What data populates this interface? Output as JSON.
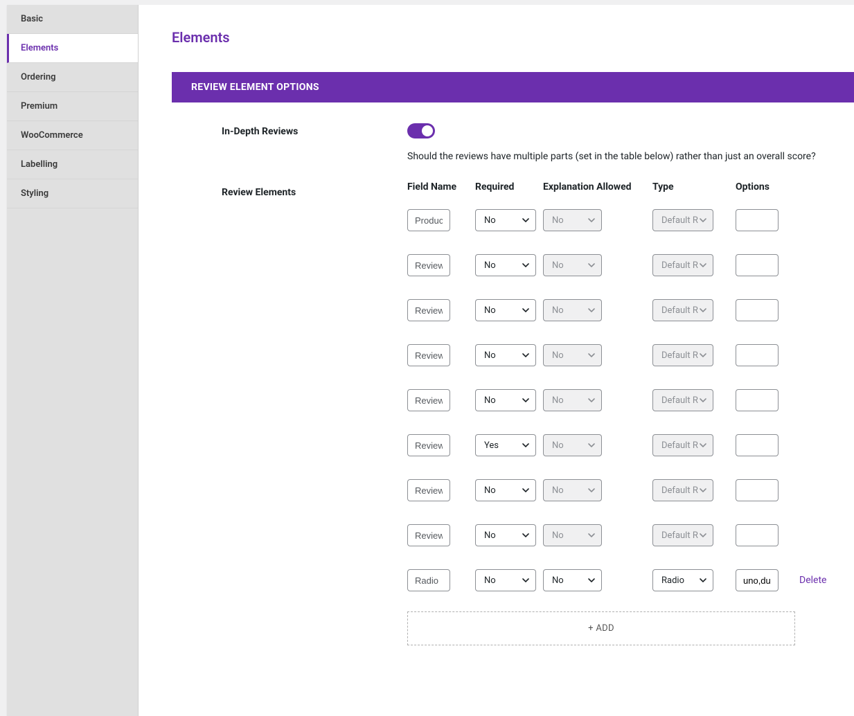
{
  "sidebar": {
    "items": [
      {
        "label": "Basic",
        "active": false
      },
      {
        "label": "Elements",
        "active": true
      },
      {
        "label": "Ordering",
        "active": false
      },
      {
        "label": "Premium",
        "active": false
      },
      {
        "label": "WooCommerce",
        "active": false
      },
      {
        "label": "Labelling",
        "active": false
      },
      {
        "label": "Styling",
        "active": false
      }
    ]
  },
  "page": {
    "title": "Elements"
  },
  "panel": {
    "header": "REVIEW ELEMENT OPTIONS"
  },
  "settings": {
    "in_depth": {
      "label": "In-Depth Reviews",
      "enabled": true,
      "description": "Should the reviews have multiple parts (set in the table below) rather than just an overall score?"
    },
    "review_elements": {
      "label": "Review Elements",
      "columns": {
        "field_name": "Field Name",
        "required": "Required",
        "explanation": "Explanation Allowed",
        "type": "Type",
        "options": "Options"
      },
      "rows": [
        {
          "field_name": "Produc",
          "required": "No",
          "required_disabled": false,
          "explanation": "No",
          "explanation_disabled": true,
          "type": "Default R",
          "type_disabled": true,
          "options": "",
          "deletable": false
        },
        {
          "field_name": "Review",
          "required": "No",
          "required_disabled": false,
          "explanation": "No",
          "explanation_disabled": true,
          "type": "Default R",
          "type_disabled": true,
          "options": "",
          "deletable": false
        },
        {
          "field_name": "Review",
          "required": "No",
          "required_disabled": false,
          "explanation": "No",
          "explanation_disabled": true,
          "type": "Default R",
          "type_disabled": true,
          "options": "",
          "deletable": false
        },
        {
          "field_name": "Review",
          "required": "No",
          "required_disabled": false,
          "explanation": "No",
          "explanation_disabled": true,
          "type": "Default R",
          "type_disabled": true,
          "options": "",
          "deletable": false
        },
        {
          "field_name": "Review",
          "required": "No",
          "required_disabled": false,
          "explanation": "No",
          "explanation_disabled": true,
          "type": "Default R",
          "type_disabled": true,
          "options": "",
          "deletable": false
        },
        {
          "field_name": "Review",
          "required": "Yes",
          "required_disabled": false,
          "explanation": "No",
          "explanation_disabled": true,
          "type": "Default R",
          "type_disabled": true,
          "options": "",
          "deletable": false
        },
        {
          "field_name": "Review",
          "required": "No",
          "required_disabled": false,
          "explanation": "No",
          "explanation_disabled": true,
          "type": "Default R",
          "type_disabled": true,
          "options": "",
          "deletable": false
        },
        {
          "field_name": "Review",
          "required": "No",
          "required_disabled": false,
          "explanation": "No",
          "explanation_disabled": true,
          "type": "Default R",
          "type_disabled": true,
          "options": "",
          "deletable": false
        },
        {
          "field_name": "Radio",
          "required": "No",
          "required_disabled": false,
          "explanation": "No",
          "explanation_disabled": false,
          "type": "Radio",
          "type_disabled": false,
          "options": "uno,du",
          "deletable": true
        }
      ],
      "add_label": "+ ADD",
      "delete_label": "Delete"
    }
  }
}
